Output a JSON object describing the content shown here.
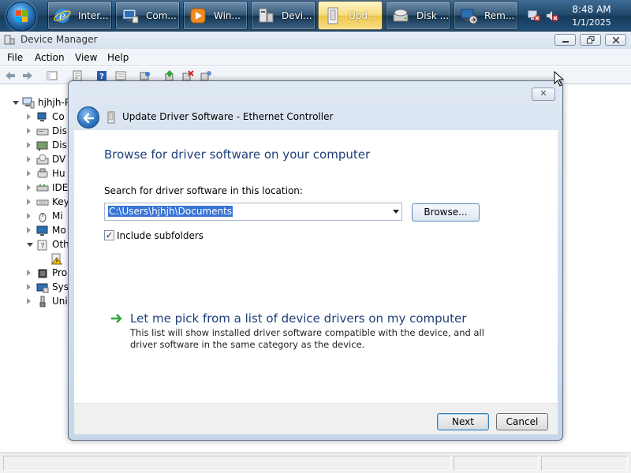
{
  "taskbar": {
    "buttons": [
      {
        "label": "Inter...",
        "icon": "internet-explorer-icon",
        "active": false
      },
      {
        "label": "Com...",
        "icon": "computer-icon",
        "active": false
      },
      {
        "label": "Win...",
        "icon": "media-player-icon",
        "active": false
      },
      {
        "label": "Devi...",
        "icon": "device-manager-icon",
        "active": false
      },
      {
        "label": "Upd...",
        "icon": "update-driver-icon",
        "active": true
      },
      {
        "label": "Disk ...",
        "icon": "disk-management-icon",
        "active": false
      },
      {
        "label": "Rem...",
        "icon": "remote-desktop-icon",
        "active": false
      }
    ],
    "tray": {
      "network_status_icon": "network-disconnected-icon",
      "volume_status_icon": "volume-muted-icon"
    },
    "clock": {
      "time": "8:48 AM",
      "date": "1/1/2025"
    }
  },
  "device_manager": {
    "title": "Device Manager",
    "menu": [
      "File",
      "Action",
      "View",
      "Help"
    ],
    "toolbar_icons": [
      "back-icon",
      "forward-icon",
      "show-hide-tree-icon",
      "properties-icon",
      "help-icon",
      "show-hidden-icon",
      "scan-hardware-icon",
      "update-driver-icon",
      "uninstall-icon",
      "disable-icon"
    ],
    "tree": {
      "root": "hjhjh-P",
      "items": [
        {
          "label": "Co",
          "icon": "computer-icon"
        },
        {
          "label": "Dis",
          "icon": "disk-drive-icon"
        },
        {
          "label": "Dis",
          "icon": "display-adapter-icon"
        },
        {
          "label": "DV",
          "icon": "dvd-drive-icon"
        },
        {
          "label": "Hu",
          "icon": "hid-icon"
        },
        {
          "label": "IDE",
          "icon": "ide-controller-icon"
        },
        {
          "label": "Key",
          "icon": "keyboard-icon"
        },
        {
          "label": "Mi",
          "icon": "mouse-icon"
        },
        {
          "label": "Mo",
          "icon": "monitor-icon"
        },
        {
          "label": "Oth",
          "icon": "other-devices-icon",
          "expanded": true
        },
        {
          "label": "",
          "icon": "unknown-device-warning-icon",
          "child": true
        },
        {
          "label": "Pro",
          "icon": "processor-icon"
        },
        {
          "label": "Sys",
          "icon": "system-devices-icon"
        },
        {
          "label": "Uni",
          "icon": "usb-controller-icon"
        }
      ]
    }
  },
  "dialog": {
    "title": "Update Driver Software - Ethernet Controller",
    "close_symbol": "✕",
    "heading": "Browse for driver software on your computer",
    "search_label": "Search for driver software in this location:",
    "path_value": "C:\\Users\\hjhjh\\Documents",
    "browse_label": "Browse...",
    "include_subfolders": {
      "label": "Include subfolders",
      "checked": true,
      "mark": "✓"
    },
    "pick_link": "Let me pick from a list of device drivers on my computer",
    "pick_description": "This list will show installed driver software compatible with the device, and all driver software in the same category as the device.",
    "next_label": "Next",
    "cancel_label": "Cancel"
  }
}
